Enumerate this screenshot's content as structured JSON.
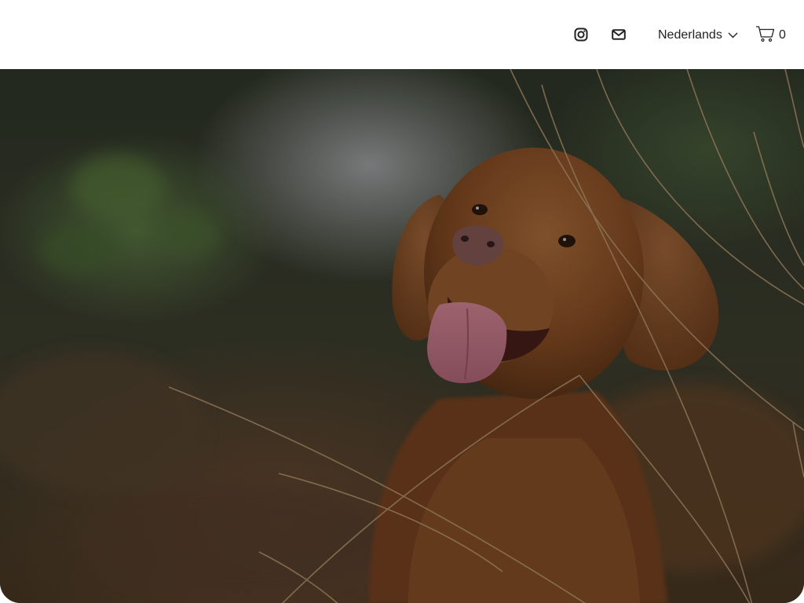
{
  "header": {
    "icons": {
      "instagram": "instagram-icon",
      "email": "mail-icon"
    },
    "language": {
      "selected": "Nederlands",
      "icon": "chevron-down-icon"
    },
    "cart": {
      "icon": "cart-icon",
      "count": "0"
    }
  },
  "hero": {
    "image_subject": "dog-photo",
    "colors": {
      "fur": "#9a5a2c",
      "background_dark": "#2f3a2a",
      "overlay": "rgba(0,0,0,0.32)"
    }
  }
}
